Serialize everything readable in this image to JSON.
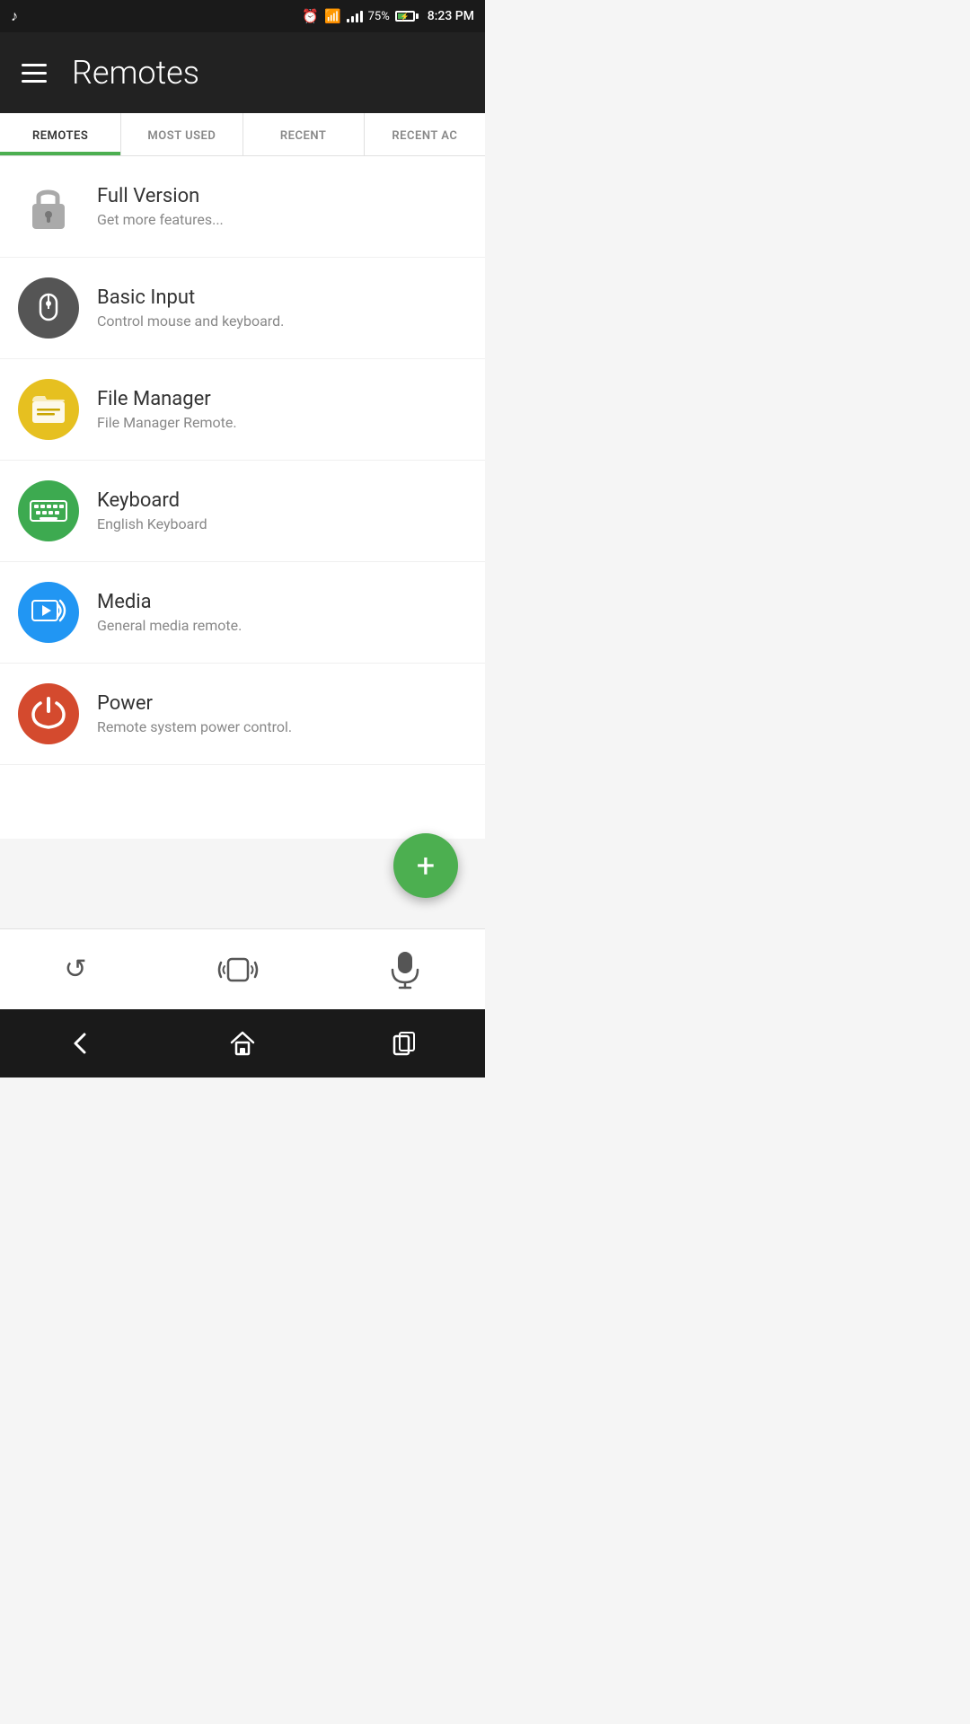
{
  "statusBar": {
    "time": "8:23 PM",
    "battery": "75%",
    "wifi": true,
    "signal": true
  },
  "header": {
    "title": "Remotes",
    "hamburger_label": "Menu"
  },
  "tabs": [
    {
      "id": "remotes",
      "label": "REMOTES",
      "active": true
    },
    {
      "id": "most_used",
      "label": "MOST USED",
      "active": false
    },
    {
      "id": "recent",
      "label": "RECENT",
      "active": false
    },
    {
      "id": "recent_ac",
      "label": "RECENT AC",
      "active": false
    }
  ],
  "listItems": [
    {
      "id": "full-version",
      "title": "Full Version",
      "subtitle": "Get more features...",
      "iconType": "lock",
      "iconColor": "transparent"
    },
    {
      "id": "basic-input",
      "title": "Basic Input",
      "subtitle": "Control mouse and keyboard.",
      "iconType": "mouse",
      "iconColor": "#555555"
    },
    {
      "id": "file-manager",
      "title": "File Manager",
      "subtitle": "File Manager Remote.",
      "iconType": "folder",
      "iconColor": "#d4ac10"
    },
    {
      "id": "keyboard",
      "title": "Keyboard",
      "subtitle": "English Keyboard",
      "iconType": "keyboard",
      "iconColor": "#3daa50"
    },
    {
      "id": "media",
      "title": "Media",
      "subtitle": "General media remote.",
      "iconType": "media",
      "iconColor": "#2196F3"
    },
    {
      "id": "power",
      "title": "Power",
      "subtitle": "Remote system power control.",
      "iconType": "power",
      "iconColor": "#d44a2e"
    }
  ],
  "fab": {
    "label": "+",
    "ariaLabel": "Add Remote"
  },
  "bottomActions": [
    {
      "id": "refresh",
      "label": "↺",
      "ariaLabel": "Refresh"
    },
    {
      "id": "vibrate",
      "label": "((□))",
      "ariaLabel": "Vibrate"
    },
    {
      "id": "mic",
      "label": "🎤",
      "ariaLabel": "Microphone"
    }
  ],
  "navBar": [
    {
      "id": "back",
      "label": "←",
      "ariaLabel": "Back"
    },
    {
      "id": "home",
      "label": "⌂",
      "ariaLabel": "Home"
    },
    {
      "id": "recents",
      "label": "▣",
      "ariaLabel": "Recents"
    }
  ]
}
